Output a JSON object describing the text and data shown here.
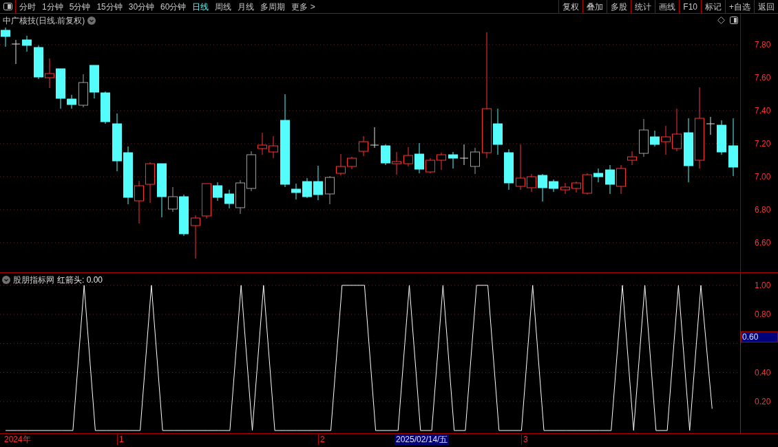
{
  "toolbar": {
    "tabs": [
      {
        "label": "分时",
        "selected": false
      },
      {
        "label": "1分钟",
        "selected": false
      },
      {
        "label": "5分钟",
        "selected": false
      },
      {
        "label": "15分钟",
        "selected": false
      },
      {
        "label": "30分钟",
        "selected": false
      },
      {
        "label": "60分钟",
        "selected": false
      },
      {
        "label": "日线",
        "selected": true
      },
      {
        "label": "周线",
        "selected": false
      },
      {
        "label": "月线",
        "selected": false
      },
      {
        "label": "多周期",
        "selected": false
      },
      {
        "label": "更多 >",
        "selected": false
      }
    ],
    "buttons": [
      "复权",
      "叠加",
      "多股",
      "统计",
      "画线",
      "F10",
      "标记",
      "+自选",
      "返回"
    ]
  },
  "main_chart": {
    "title": "中广核技(日线.前复权)",
    "price_axis": [
      "7.80",
      "7.60",
      "7.40",
      "7.20",
      "7.00",
      "6.80",
      "6.60"
    ]
  },
  "indicator": {
    "name": "股朋指标网",
    "reading": "红箭头: 0.00",
    "cursor_value": "0.60",
    "chart_data": {
      "type": "line",
      "grid": true,
      "ylim": [
        -0.019,
        1.085
      ],
      "categories": [
        null,
        null,
        null,
        null,
        null,
        null,
        null,
        null,
        null,
        null,
        null,
        null,
        null,
        null,
        null,
        null,
        null,
        null,
        null,
        null,
        null,
        null,
        null,
        null,
        null,
        null,
        null,
        null,
        null,
        null,
        null,
        null,
        null,
        null,
        null,
        null,
        null,
        null,
        null,
        null,
        null,
        null,
        null,
        null,
        null,
        null,
        null,
        null,
        null,
        null,
        null,
        null,
        null,
        null,
        null,
        null,
        null,
        null,
        null,
        null,
        null,
        null,
        null,
        null,
        null,
        null
      ],
      "yticks": [
        {
          "value": 0.2,
          "label": "0.20"
        },
        {
          "value": 0.4,
          "label": "0.40"
        },
        {
          "value": 0.8,
          "label": "0.80"
        },
        {
          "value": 1.0,
          "label": "1.00"
        }
      ],
      "series": [
        {
          "color": "#ffffff",
          "values": [
            0,
            0,
            0,
            0,
            0,
            0,
            0,
            1,
            0,
            0,
            0,
            0,
            0,
            1,
            0,
            0,
            0,
            0,
            0,
            0,
            0,
            1,
            0,
            1,
            0,
            0,
            0,
            0,
            0,
            0,
            1,
            1,
            1,
            0,
            0,
            0,
            1,
            0,
            0,
            1,
            0,
            0,
            1,
            1,
            0,
            0,
            0,
            1,
            0,
            0,
            0,
            0,
            0,
            0,
            0,
            1,
            0,
            1,
            0,
            0,
            1,
            0,
            1,
            0.15,
            null,
            null
          ]
        }
      ]
    }
  },
  "date_axis": [
    {
      "label": "2024年",
      "kind": "year"
    },
    {
      "label": "1",
      "kind": "month"
    },
    {
      "label": "2",
      "kind": "month"
    },
    {
      "label": "2025/02/14/五",
      "kind": "cursor"
    },
    {
      "label": "3",
      "kind": "month"
    }
  ]
}
